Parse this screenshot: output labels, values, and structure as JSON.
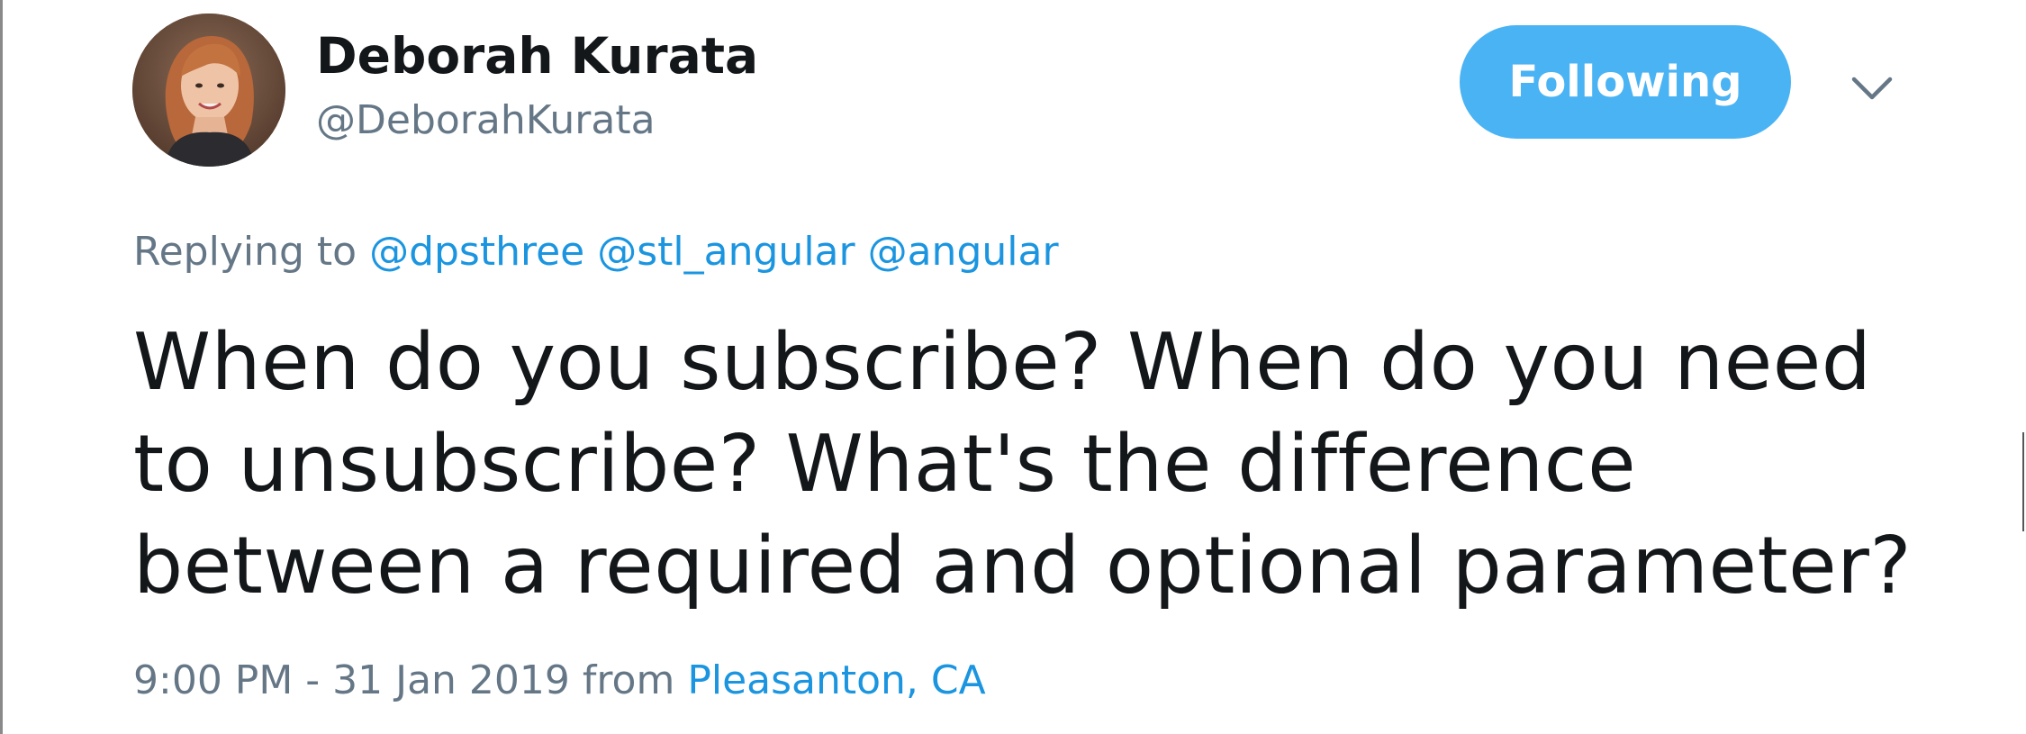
{
  "tweet": {
    "author": {
      "display_name": "Deborah Kurata",
      "handle": "@DeborahKurata",
      "avatar_icon": "profile-photo"
    },
    "follow_button_label": "Following",
    "menu_icon": "chevron-down-icon",
    "replying_to": {
      "prefix": "Replying to",
      "mentions": [
        "@dpsthree",
        "@stl_angular",
        "@angular"
      ]
    },
    "text_lines": [
      "When do you subscribe? When do you need",
      "to unsubscribe? What's the difference",
      "between a required and optional parameter?"
    ],
    "timestamp": "9:00 PM - 31 Jan 2019",
    "from_label": "from",
    "location": "Pleasanton, CA"
  },
  "colors": {
    "button_blue": "#4ab3f4",
    "link_blue": "#1b95e0",
    "muted_gray": "#657786",
    "text_dark": "#14171a"
  }
}
